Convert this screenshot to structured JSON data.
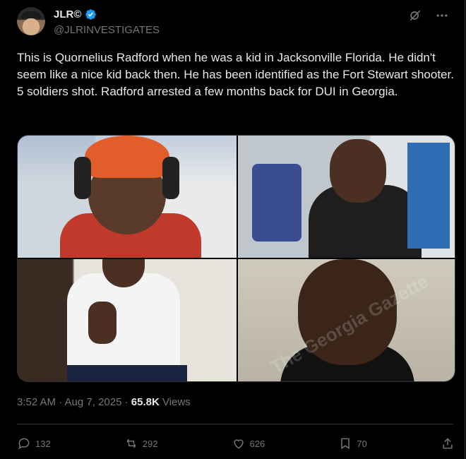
{
  "author": {
    "name": "JLR©",
    "handle": "@JLRINVESTIGATES"
  },
  "tweet": {
    "text": "This is Quornelius Radford when he was a kid in Jacksonville Florida. He didn't seem like a nice kid back then. He has been identified as the Fort Stewart shooter. 5 soldiers shot. Radford arrested a few months back for DUI in Georgia.",
    "time": "3:52 AM · Aug 7, 2025 · ",
    "views_count": "65.8K",
    "views_label": " Views"
  },
  "media": {
    "watermark": "The Georgia Gazette"
  },
  "actions": {
    "replies": "132",
    "reposts": "292",
    "likes": "626",
    "bookmarks": "70"
  },
  "colors": {
    "background": "#000000",
    "text": "#e7e9ea",
    "muted": "#71767b",
    "verified": "#1d9bf0"
  }
}
